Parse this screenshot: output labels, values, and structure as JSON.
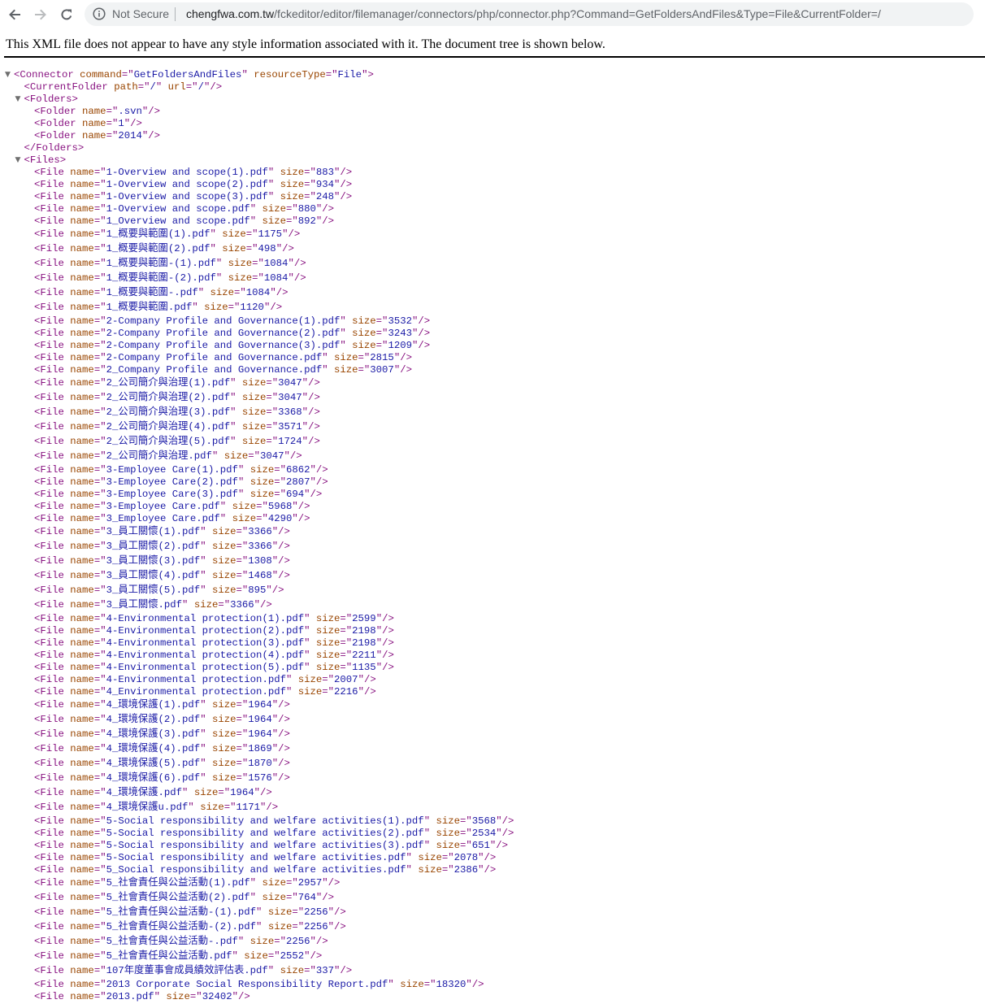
{
  "browser": {
    "security_label": "Not Secure",
    "url_host": "chengfwa.com.tw",
    "url_path": "/fckeditor/editor/filemanager/connectors/php/connector.php?Command=GetFoldersAndFiles&Type=File&CurrentFolder=/",
    "icons": {
      "back": "arrow-left-icon",
      "forward": "arrow-right-icon",
      "reload": "reload-icon",
      "info": "info-circle-icon"
    }
  },
  "notice": "This XML file does not appear to have any style information associated with it. The document tree is shown below.",
  "connector": {
    "command": "GetFoldersAndFiles",
    "resourceType": "File"
  },
  "current_folder": {
    "path": "/",
    "url": "/"
  },
  "folders": [
    ".svn",
    "1",
    "2014"
  ],
  "files": [
    {
      "name": "1-Overview and scope(1).pdf",
      "size": "883"
    },
    {
      "name": "1-Overview and scope(2).pdf",
      "size": "934"
    },
    {
      "name": "1-Overview and scope(3).pdf",
      "size": "248"
    },
    {
      "name": "1-Overview and scope.pdf",
      "size": "880"
    },
    {
      "name": "1_Overview and scope.pdf",
      "size": "892"
    },
    {
      "name": "1_概要與範圍(1).pdf",
      "size": "1175"
    },
    {
      "name": "1_概要與範圍(2).pdf",
      "size": "498"
    },
    {
      "name": "1_概要與範圍-(1).pdf",
      "size": "1084"
    },
    {
      "name": "1_概要與範圍-(2).pdf",
      "size": "1084"
    },
    {
      "name": "1_概要與範圍-.pdf",
      "size": "1084"
    },
    {
      "name": "1_概要與範圍.pdf",
      "size": "1120"
    },
    {
      "name": "2-Company Profile and Governance(1).pdf",
      "size": "3532"
    },
    {
      "name": "2-Company Profile and Governance(2).pdf",
      "size": "3243"
    },
    {
      "name": "2-Company Profile and Governance(3).pdf",
      "size": "1209"
    },
    {
      "name": "2-Company Profile and Governance.pdf",
      "size": "2815"
    },
    {
      "name": "2_Company Profile and Governance.pdf",
      "size": "3007"
    },
    {
      "name": "2_公司簡介與治理(1).pdf",
      "size": "3047"
    },
    {
      "name": "2_公司簡介與治理(2).pdf",
      "size": "3047"
    },
    {
      "name": "2_公司簡介與治理(3).pdf",
      "size": "3368"
    },
    {
      "name": "2_公司簡介與治理(4).pdf",
      "size": "3571"
    },
    {
      "name": "2_公司簡介與治理(5).pdf",
      "size": "1724"
    },
    {
      "name": "2_公司簡介與治理.pdf",
      "size": "3047"
    },
    {
      "name": "3-Employee Care(1).pdf",
      "size": "6862"
    },
    {
      "name": "3-Employee Care(2).pdf",
      "size": "2807"
    },
    {
      "name": "3-Employee Care(3).pdf",
      "size": "694"
    },
    {
      "name": "3-Employee Care.pdf",
      "size": "5968"
    },
    {
      "name": "3_Employee Care.pdf",
      "size": "4290"
    },
    {
      "name": "3_員工關懷(1).pdf",
      "size": "3366"
    },
    {
      "name": "3_員工關懷(2).pdf",
      "size": "3366"
    },
    {
      "name": "3_員工關懷(3).pdf",
      "size": "1308"
    },
    {
      "name": "3_員工關懷(4).pdf",
      "size": "1468"
    },
    {
      "name": "3_員工關懷(5).pdf",
      "size": "895"
    },
    {
      "name": "3_員工關懷.pdf",
      "size": "3366"
    },
    {
      "name": "4-Environmental protection(1).pdf",
      "size": "2599"
    },
    {
      "name": "4-Environmental protection(2).pdf",
      "size": "2198"
    },
    {
      "name": "4-Environmental protection(3).pdf",
      "size": "2198"
    },
    {
      "name": "4-Environmental protection(4).pdf",
      "size": "2211"
    },
    {
      "name": "4-Environmental protection(5).pdf",
      "size": "1135"
    },
    {
      "name": "4-Environmental protection.pdf",
      "size": "2007"
    },
    {
      "name": "4_Environmental protection.pdf",
      "size": "2216"
    },
    {
      "name": "4_環境保護(1).pdf",
      "size": "1964"
    },
    {
      "name": "4_環境保護(2).pdf",
      "size": "1964"
    },
    {
      "name": "4_環境保護(3).pdf",
      "size": "1964"
    },
    {
      "name": "4_環境保護(4).pdf",
      "size": "1869"
    },
    {
      "name": "4_環境保護(5).pdf",
      "size": "1870"
    },
    {
      "name": "4_環境保護(6).pdf",
      "size": "1576"
    },
    {
      "name": "4_環境保護.pdf",
      "size": "1964"
    },
    {
      "name": "4_環境保護u.pdf",
      "size": "1171"
    },
    {
      "name": "5-Social responsibility and welfare activities(1).pdf",
      "size": "3568"
    },
    {
      "name": "5-Social responsibility and welfare activities(2).pdf",
      "size": "2534"
    },
    {
      "name": "5-Social responsibility and welfare activities(3).pdf",
      "size": "651"
    },
    {
      "name": "5-Social responsibility and welfare activities.pdf",
      "size": "2078"
    },
    {
      "name": "5_Social responsibility and welfare activities.pdf",
      "size": "2386"
    },
    {
      "name": "5_社會責任與公益活動(1).pdf",
      "size": "2957"
    },
    {
      "name": "5_社會責任與公益活動(2).pdf",
      "size": "764"
    },
    {
      "name": "5_社會責任與公益活動-(1).pdf",
      "size": "2256"
    },
    {
      "name": "5_社會責任與公益活動-(2).pdf",
      "size": "2256"
    },
    {
      "name": "5_社會責任與公益活動-.pdf",
      "size": "2256"
    },
    {
      "name": "5_社會責任與公益活動.pdf",
      "size": "2552"
    },
    {
      "name": "107年度董事會成員績效評估表.pdf",
      "size": "337"
    },
    {
      "name": "2013 Corporate Social Responsibility Report.pdf",
      "size": "18320"
    },
    {
      "name": "2013.pdf",
      "size": "32402"
    }
  ],
  "colors": {
    "tag": "#881280",
    "attr_name": "#994500",
    "attr_value": "#1a1aa6",
    "triangle": "#6e6e6e"
  }
}
